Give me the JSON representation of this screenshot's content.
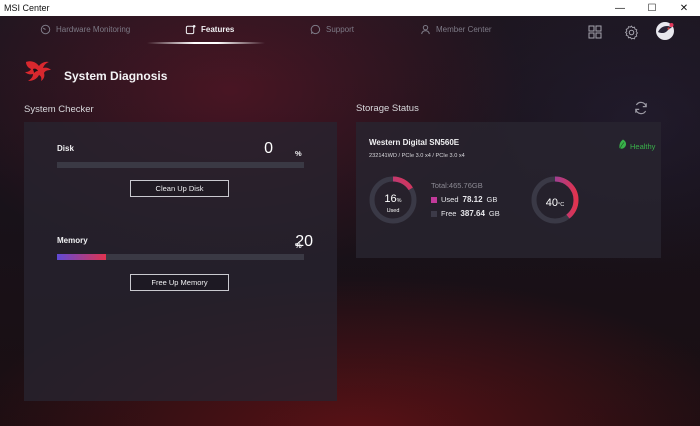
{
  "window": {
    "title": "MSI Center",
    "controls": [
      "—",
      "☐",
      "✕"
    ]
  },
  "nav": {
    "tabs": [
      {
        "label": "Hardware Monitoring",
        "icon": "gauge-icon",
        "active": false
      },
      {
        "label": "Features",
        "icon": "feature-icon",
        "active": true
      },
      {
        "label": "Support",
        "icon": "support-icon",
        "active": false
      },
      {
        "label": "Member Center",
        "icon": "user-icon",
        "active": false
      }
    ],
    "right_icons": [
      "grid-icon",
      "settings-gear-icon",
      "avatar-icon"
    ]
  },
  "page": {
    "title": "System Diagnosis",
    "logo": "dragon-logo-icon"
  },
  "system_checker": {
    "heading": "System Checker",
    "disk": {
      "label": "Disk",
      "value": "0",
      "unit": "%",
      "fill": 0,
      "button": "Clean Up Disk"
    },
    "memory": {
      "label": "Memory",
      "value": "20",
      "unit": "%",
      "fill": 0.2,
      "button": "Free Up Memory"
    }
  },
  "storage": {
    "heading": "Storage Status",
    "refresh_icon": "refresh-icon",
    "drive": {
      "name": "Western Digital SN560E",
      "details": "232141WD / PCIe 3.0 x4 / PCIe 3.0 x4",
      "status": "Healthy",
      "status_color": "#39b04a",
      "usage_value": "16",
      "usage_unit": "%",
      "usage_label": "Used",
      "usage_fraction": 0.16,
      "total": "Total:465.76GB",
      "used_label": "Used",
      "used_value": "78.12",
      "used_unit": "GB",
      "free_label": "Free",
      "free_value": "387.64",
      "free_unit": "GB",
      "temperature_value": "40",
      "temperature_unit": "°C"
    }
  },
  "colors": {
    "accent_start": "#5f4ad6",
    "accent_end": "#e0334f",
    "used_swatch": "#c23a9a",
    "free_swatch": "#3c3a48"
  }
}
